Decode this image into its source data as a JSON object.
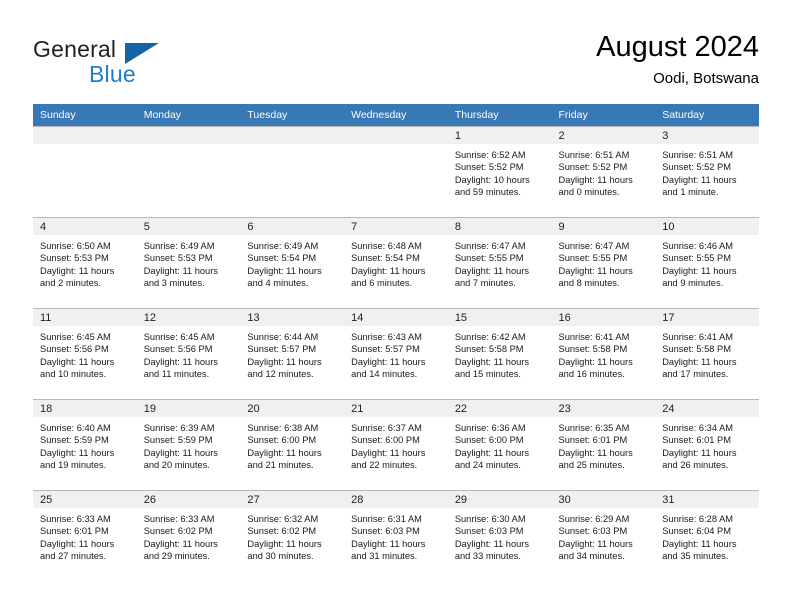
{
  "brand": {
    "name_top": "General",
    "name_bottom": "Blue",
    "triangle_color": "#1464a5",
    "blue_text_color": "#1f7ec8"
  },
  "header": {
    "title": "August 2024",
    "subtitle": "Oodi, Botswana",
    "header_bg": "#3878b4",
    "header_text_color": "#ffffff",
    "datebar_bg": "#f0f0f0"
  },
  "weekdays": [
    "Sunday",
    "Monday",
    "Tuesday",
    "Wednesday",
    "Thursday",
    "Friday",
    "Saturday"
  ],
  "weeks": [
    [
      {
        "date": "",
        "sunrise": "",
        "sunset": "",
        "daylight_1": "",
        "daylight_2": ""
      },
      {
        "date": "",
        "sunrise": "",
        "sunset": "",
        "daylight_1": "",
        "daylight_2": ""
      },
      {
        "date": "",
        "sunrise": "",
        "sunset": "",
        "daylight_1": "",
        "daylight_2": ""
      },
      {
        "date": "",
        "sunrise": "",
        "sunset": "",
        "daylight_1": "",
        "daylight_2": ""
      },
      {
        "date": "1",
        "sunrise": "Sunrise: 6:52 AM",
        "sunset": "Sunset: 5:52 PM",
        "daylight_1": "Daylight: 10 hours",
        "daylight_2": "and 59 minutes."
      },
      {
        "date": "2",
        "sunrise": "Sunrise: 6:51 AM",
        "sunset": "Sunset: 5:52 PM",
        "daylight_1": "Daylight: 11 hours",
        "daylight_2": "and 0 minutes."
      },
      {
        "date": "3",
        "sunrise": "Sunrise: 6:51 AM",
        "sunset": "Sunset: 5:52 PM",
        "daylight_1": "Daylight: 11 hours",
        "daylight_2": "and 1 minute."
      }
    ],
    [
      {
        "date": "4",
        "sunrise": "Sunrise: 6:50 AM",
        "sunset": "Sunset: 5:53 PM",
        "daylight_1": "Daylight: 11 hours",
        "daylight_2": "and 2 minutes."
      },
      {
        "date": "5",
        "sunrise": "Sunrise: 6:49 AM",
        "sunset": "Sunset: 5:53 PM",
        "daylight_1": "Daylight: 11 hours",
        "daylight_2": "and 3 minutes."
      },
      {
        "date": "6",
        "sunrise": "Sunrise: 6:49 AM",
        "sunset": "Sunset: 5:54 PM",
        "daylight_1": "Daylight: 11 hours",
        "daylight_2": "and 4 minutes."
      },
      {
        "date": "7",
        "sunrise": "Sunrise: 6:48 AM",
        "sunset": "Sunset: 5:54 PM",
        "daylight_1": "Daylight: 11 hours",
        "daylight_2": "and 6 minutes."
      },
      {
        "date": "8",
        "sunrise": "Sunrise: 6:47 AM",
        "sunset": "Sunset: 5:55 PM",
        "daylight_1": "Daylight: 11 hours",
        "daylight_2": "and 7 minutes."
      },
      {
        "date": "9",
        "sunrise": "Sunrise: 6:47 AM",
        "sunset": "Sunset: 5:55 PM",
        "daylight_1": "Daylight: 11 hours",
        "daylight_2": "and 8 minutes."
      },
      {
        "date": "10",
        "sunrise": "Sunrise: 6:46 AM",
        "sunset": "Sunset: 5:55 PM",
        "daylight_1": "Daylight: 11 hours",
        "daylight_2": "and 9 minutes."
      }
    ],
    [
      {
        "date": "11",
        "sunrise": "Sunrise: 6:45 AM",
        "sunset": "Sunset: 5:56 PM",
        "daylight_1": "Daylight: 11 hours",
        "daylight_2": "and 10 minutes."
      },
      {
        "date": "12",
        "sunrise": "Sunrise: 6:45 AM",
        "sunset": "Sunset: 5:56 PM",
        "daylight_1": "Daylight: 11 hours",
        "daylight_2": "and 11 minutes."
      },
      {
        "date": "13",
        "sunrise": "Sunrise: 6:44 AM",
        "sunset": "Sunset: 5:57 PM",
        "daylight_1": "Daylight: 11 hours",
        "daylight_2": "and 12 minutes."
      },
      {
        "date": "14",
        "sunrise": "Sunrise: 6:43 AM",
        "sunset": "Sunset: 5:57 PM",
        "daylight_1": "Daylight: 11 hours",
        "daylight_2": "and 14 minutes."
      },
      {
        "date": "15",
        "sunrise": "Sunrise: 6:42 AM",
        "sunset": "Sunset: 5:58 PM",
        "daylight_1": "Daylight: 11 hours",
        "daylight_2": "and 15 minutes."
      },
      {
        "date": "16",
        "sunrise": "Sunrise: 6:41 AM",
        "sunset": "Sunset: 5:58 PM",
        "daylight_1": "Daylight: 11 hours",
        "daylight_2": "and 16 minutes."
      },
      {
        "date": "17",
        "sunrise": "Sunrise: 6:41 AM",
        "sunset": "Sunset: 5:58 PM",
        "daylight_1": "Daylight: 11 hours",
        "daylight_2": "and 17 minutes."
      }
    ],
    [
      {
        "date": "18",
        "sunrise": "Sunrise: 6:40 AM",
        "sunset": "Sunset: 5:59 PM",
        "daylight_1": "Daylight: 11 hours",
        "daylight_2": "and 19 minutes."
      },
      {
        "date": "19",
        "sunrise": "Sunrise: 6:39 AM",
        "sunset": "Sunset: 5:59 PM",
        "daylight_1": "Daylight: 11 hours",
        "daylight_2": "and 20 minutes."
      },
      {
        "date": "20",
        "sunrise": "Sunrise: 6:38 AM",
        "sunset": "Sunset: 6:00 PM",
        "daylight_1": "Daylight: 11 hours",
        "daylight_2": "and 21 minutes."
      },
      {
        "date": "21",
        "sunrise": "Sunrise: 6:37 AM",
        "sunset": "Sunset: 6:00 PM",
        "daylight_1": "Daylight: 11 hours",
        "daylight_2": "and 22 minutes."
      },
      {
        "date": "22",
        "sunrise": "Sunrise: 6:36 AM",
        "sunset": "Sunset: 6:00 PM",
        "daylight_1": "Daylight: 11 hours",
        "daylight_2": "and 24 minutes."
      },
      {
        "date": "23",
        "sunrise": "Sunrise: 6:35 AM",
        "sunset": "Sunset: 6:01 PM",
        "daylight_1": "Daylight: 11 hours",
        "daylight_2": "and 25 minutes."
      },
      {
        "date": "24",
        "sunrise": "Sunrise: 6:34 AM",
        "sunset": "Sunset: 6:01 PM",
        "daylight_1": "Daylight: 11 hours",
        "daylight_2": "and 26 minutes."
      }
    ],
    [
      {
        "date": "25",
        "sunrise": "Sunrise: 6:33 AM",
        "sunset": "Sunset: 6:01 PM",
        "daylight_1": "Daylight: 11 hours",
        "daylight_2": "and 27 minutes."
      },
      {
        "date": "26",
        "sunrise": "Sunrise: 6:33 AM",
        "sunset": "Sunset: 6:02 PM",
        "daylight_1": "Daylight: 11 hours",
        "daylight_2": "and 29 minutes."
      },
      {
        "date": "27",
        "sunrise": "Sunrise: 6:32 AM",
        "sunset": "Sunset: 6:02 PM",
        "daylight_1": "Daylight: 11 hours",
        "daylight_2": "and 30 minutes."
      },
      {
        "date": "28",
        "sunrise": "Sunrise: 6:31 AM",
        "sunset": "Sunset: 6:03 PM",
        "daylight_1": "Daylight: 11 hours",
        "daylight_2": "and 31 minutes."
      },
      {
        "date": "29",
        "sunrise": "Sunrise: 6:30 AM",
        "sunset": "Sunset: 6:03 PM",
        "daylight_1": "Daylight: 11 hours",
        "daylight_2": "and 33 minutes."
      },
      {
        "date": "30",
        "sunrise": "Sunrise: 6:29 AM",
        "sunset": "Sunset: 6:03 PM",
        "daylight_1": "Daylight: 11 hours",
        "daylight_2": "and 34 minutes."
      },
      {
        "date": "31",
        "sunrise": "Sunrise: 6:28 AM",
        "sunset": "Sunset: 6:04 PM",
        "daylight_1": "Daylight: 11 hours",
        "daylight_2": "and 35 minutes."
      }
    ]
  ]
}
